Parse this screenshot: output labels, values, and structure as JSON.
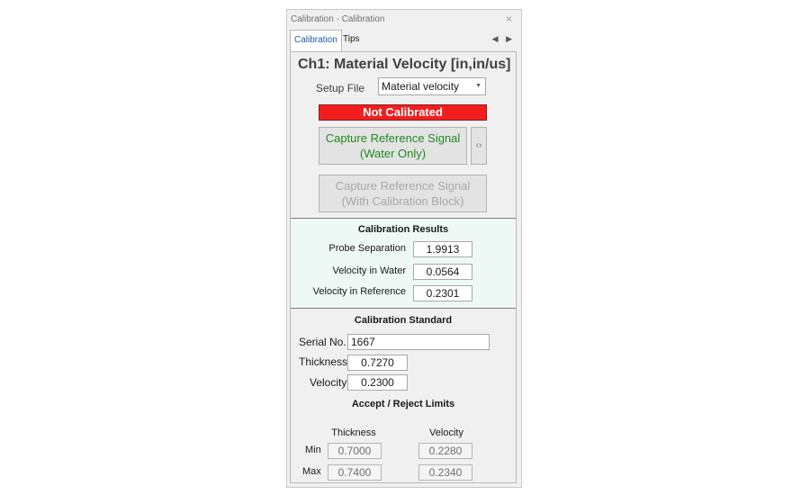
{
  "window": {
    "title": "Calibration - Calibration",
    "close_glyph": "×"
  },
  "tabs": [
    {
      "label": "Calibration",
      "active": true
    },
    {
      "label": "Tips",
      "active": false
    }
  ],
  "tab_nav": {
    "left": "◀",
    "right": "▶"
  },
  "header": {
    "title": "Ch1: Material Velocity [in,in/us]"
  },
  "setup": {
    "label": "Setup File",
    "selected": "Material velocity",
    "caret": "▼"
  },
  "status": {
    "text": "Not Calibrated",
    "color": "#f21e1e"
  },
  "buttons": {
    "water": {
      "line1": "Capture Reference Signal",
      "line2": "(Water Only)",
      "enabled": true
    },
    "side": {
      "label": "‹›"
    },
    "block": {
      "line1": "Capture Reference Signal",
      "line2": "(With Calibration Block)",
      "enabled": false
    }
  },
  "results": {
    "title": "Calibration Results",
    "rows": [
      {
        "label": "Probe Separation",
        "value": "1.9913"
      },
      {
        "label": "Velocity in Water",
        "value": "0.0564"
      },
      {
        "label": "Velocity in Reference",
        "value": "0.2301"
      }
    ]
  },
  "standard": {
    "title": "Calibration Standard",
    "serial_label": "Serial No.",
    "serial_value": "1667",
    "thickness_label": "Thickness",
    "thickness_value": "0.7270",
    "velocity_label": "Velocity",
    "velocity_value": "0.2300"
  },
  "limits": {
    "title": "Accept / Reject Limits",
    "col_thickness": "Thickness",
    "col_velocity": "Velocity",
    "min_label": "Min",
    "max_label": "Max",
    "thickness_min": "0.7000",
    "thickness_max": "0.7400",
    "velocity_min": "0.2280",
    "velocity_max": "0.2340"
  }
}
